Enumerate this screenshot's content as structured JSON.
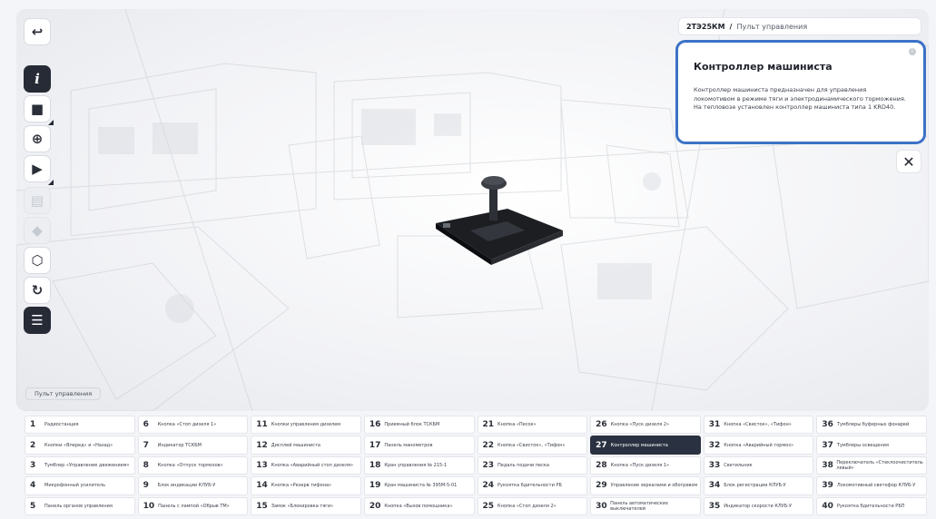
{
  "breadcrumb": {
    "locomotive": "2ТЭ25КМ",
    "separator": "/",
    "section": "Пульт управления"
  },
  "info_panel": {
    "title": "Контроллер машиниста",
    "description": "Контроллер машиниста предназначен для управления локомотивом в режиме тяги и электродинамического торможения. На тепловозе установлен контроллер машиниста типа 1 KRD40.",
    "corner_icon": "info-circle-icon"
  },
  "close_button": {
    "icon": "close-icon",
    "glyph": "✕"
  },
  "scene_label": "Пульт управления",
  "toolbar": [
    {
      "name": "back-button",
      "icon": "back-arrow-icon",
      "glyph": "↩",
      "style": "light"
    },
    {
      "name": "info-button",
      "icon": "info-icon",
      "glyph": "i",
      "style": "dark"
    },
    {
      "name": "shape-button",
      "icon": "square-icon",
      "glyph": "■",
      "style": "light"
    },
    {
      "name": "rotate-view-button",
      "icon": "orbit-icon",
      "glyph": "⊕",
      "style": "light"
    },
    {
      "name": "camera-button",
      "icon": "camera-icon",
      "glyph": "▶",
      "style": "light"
    },
    {
      "name": "document-button",
      "icon": "document-icon",
      "glyph": "▤",
      "style": "disabled"
    },
    {
      "name": "cube-button",
      "icon": "cube-icon",
      "glyph": "◆",
      "style": "disabled"
    },
    {
      "name": "settings-button",
      "icon": "hexagon-icon",
      "glyph": "⬡",
      "style": "light"
    },
    {
      "name": "reset-button",
      "icon": "refresh-icon",
      "glyph": "↻",
      "style": "light"
    },
    {
      "name": "list-button",
      "icon": "list-icon",
      "glyph": "☰",
      "style": "dark"
    }
  ],
  "components": [
    {
      "num": "1",
      "label": "Радиостанция"
    },
    {
      "num": "2",
      "label": "Кнопки «Вперед» и «Назад»"
    },
    {
      "num": "3",
      "label": "Тумблер «Управление движением»"
    },
    {
      "num": "4",
      "label": "Микрофонный усилитель"
    },
    {
      "num": "5",
      "label": "Панель органов управления"
    },
    {
      "num": "6",
      "label": "Кнопка «Стоп дизеля 1»"
    },
    {
      "num": "7",
      "label": "Индикатор ТСКБМ"
    },
    {
      "num": "8",
      "label": "Кнопка «Отпуск тормозов»"
    },
    {
      "num": "9",
      "label": "Блок индикации КЛУБ-У"
    },
    {
      "num": "10",
      "label": "Панель с лампой «Обрыв ТМ»"
    },
    {
      "num": "11",
      "label": "Кнопки управления дизелем"
    },
    {
      "num": "12",
      "label": "Дисплей машиниста"
    },
    {
      "num": "13",
      "label": "Кнопка «Аварийный стоп дизеля»"
    },
    {
      "num": "14",
      "label": "Кнопка «Резерв тифона»"
    },
    {
      "num": "15",
      "label": "Замок «Блокировка тяги»"
    },
    {
      "num": "16",
      "label": "Приемный блок ТСКБМ"
    },
    {
      "num": "17",
      "label": "Панель манометров"
    },
    {
      "num": "18",
      "label": "Кран управления № 215-1"
    },
    {
      "num": "19",
      "label": "Кран машиниста № 395М-5-01"
    },
    {
      "num": "20",
      "label": "Кнопка «Вызов помощника»"
    },
    {
      "num": "21",
      "label": "Кнопка «Песок»"
    },
    {
      "num": "22",
      "label": "Кнопка «Свисток», «Тифон»"
    },
    {
      "num": "23",
      "label": "Педаль подачи песка"
    },
    {
      "num": "24",
      "label": "Рукоятка бдительности РБ"
    },
    {
      "num": "25",
      "label": "Кнопка «Стоп дизеля 2»"
    },
    {
      "num": "26",
      "label": "Кнопка «Пуск дизеля 2»"
    },
    {
      "num": "27",
      "label": "Контроллер машиниста",
      "active": true
    },
    {
      "num": "28",
      "label": "Кнопка «Пуск дизеля 1»"
    },
    {
      "num": "29",
      "label": "Управление зеркалами и обогревом"
    },
    {
      "num": "30",
      "label": "Панель автоматических выключателей"
    },
    {
      "num": "31",
      "label": "Кнопка «Свисток», «Тифон»"
    },
    {
      "num": "32",
      "label": "Кнопка «Аварийный тормоз»"
    },
    {
      "num": "33",
      "label": "Светильник"
    },
    {
      "num": "34",
      "label": "Блок регистрации КЛУБ-У"
    },
    {
      "num": "35",
      "label": "Индикатор скорости КЛУБ-У"
    },
    {
      "num": "36",
      "label": "Тумблеры буферных фонарей"
    },
    {
      "num": "37",
      "label": "Тумблеры освещения"
    },
    {
      "num": "38",
      "label": "Переключатель «Стеклоочиститель левый»"
    },
    {
      "num": "39",
      "label": "Локомотивный светофор КЛУБ-У"
    },
    {
      "num": "40",
      "label": "Рукоятка бдительности РБП"
    }
  ]
}
